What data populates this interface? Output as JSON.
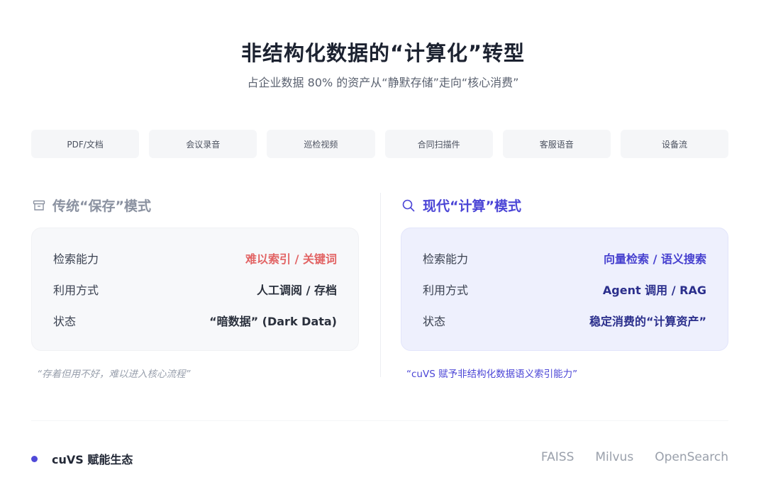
{
  "header": {
    "title": "非结构化数据的“计算化”转型",
    "subtitle": "占企业数据 80% 的资产从“静默存储”走向“核心消费”"
  },
  "chips": [
    "PDF/文档",
    "会议录音",
    "巡检视频",
    "合同扫描件",
    "客服语音",
    "设备流"
  ],
  "traditional": {
    "heading": "传统“保存”模式",
    "icon": "archive-box-icon",
    "rows": [
      {
        "key": "检索能力",
        "value": "难以索引 / 关键词"
      },
      {
        "key": "利用方式",
        "value": "人工调阅 / 存档"
      },
      {
        "key": "状态",
        "value": "“暗数据” (Dark Data)"
      }
    ],
    "quote": "“存着但用不好，难以进入核心流程”",
    "warn_color": "#e26464"
  },
  "modern": {
    "heading": "现代“计算”模式",
    "icon": "magnifier-icon",
    "rows": [
      {
        "key": "检索能力",
        "value": "向量检索 / 语义搜索"
      },
      {
        "key": "利用方式",
        "value": "Agent 调用 / RAG"
      },
      {
        "key": "状态",
        "value": "稳定消费的“计算资产”"
      }
    ],
    "quote": "“cuVS 赋予非结构化数据语义索引能力”",
    "accent_color": "#4b45d6"
  },
  "ecosystem": {
    "label": "cuVS 赋能生态",
    "partners": [
      "FAISS",
      "Milvus",
      "OpenSearch"
    ]
  }
}
